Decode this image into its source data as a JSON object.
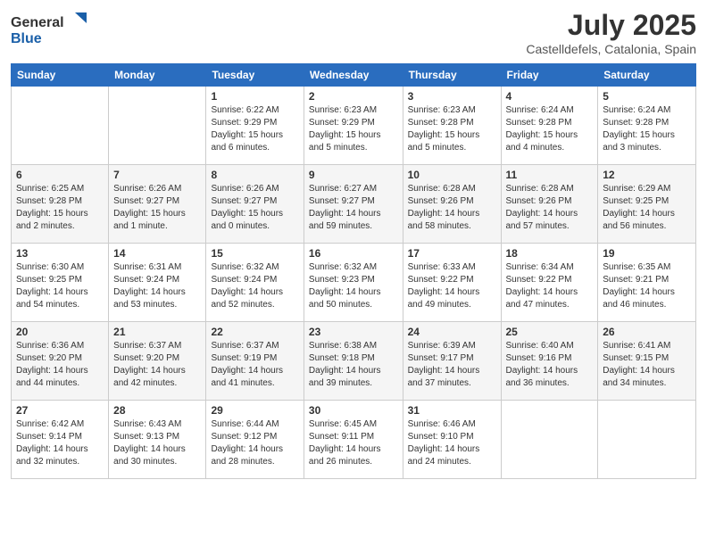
{
  "header": {
    "logo_general": "General",
    "logo_blue": "Blue",
    "month_title": "July 2025",
    "location": "Castelldefels, Catalonia, Spain"
  },
  "weekdays": [
    "Sunday",
    "Monday",
    "Tuesday",
    "Wednesday",
    "Thursday",
    "Friday",
    "Saturday"
  ],
  "weeks": [
    [
      {
        "day": "",
        "info": ""
      },
      {
        "day": "",
        "info": ""
      },
      {
        "day": "1",
        "info": "Sunrise: 6:22 AM\nSunset: 9:29 PM\nDaylight: 15 hours and 6 minutes."
      },
      {
        "day": "2",
        "info": "Sunrise: 6:23 AM\nSunset: 9:29 PM\nDaylight: 15 hours and 5 minutes."
      },
      {
        "day": "3",
        "info": "Sunrise: 6:23 AM\nSunset: 9:28 PM\nDaylight: 15 hours and 5 minutes."
      },
      {
        "day": "4",
        "info": "Sunrise: 6:24 AM\nSunset: 9:28 PM\nDaylight: 15 hours and 4 minutes."
      },
      {
        "day": "5",
        "info": "Sunrise: 6:24 AM\nSunset: 9:28 PM\nDaylight: 15 hours and 3 minutes."
      }
    ],
    [
      {
        "day": "6",
        "info": "Sunrise: 6:25 AM\nSunset: 9:28 PM\nDaylight: 15 hours and 2 minutes."
      },
      {
        "day": "7",
        "info": "Sunrise: 6:26 AM\nSunset: 9:27 PM\nDaylight: 15 hours and 1 minute."
      },
      {
        "day": "8",
        "info": "Sunrise: 6:26 AM\nSunset: 9:27 PM\nDaylight: 15 hours and 0 minutes."
      },
      {
        "day": "9",
        "info": "Sunrise: 6:27 AM\nSunset: 9:27 PM\nDaylight: 14 hours and 59 minutes."
      },
      {
        "day": "10",
        "info": "Sunrise: 6:28 AM\nSunset: 9:26 PM\nDaylight: 14 hours and 58 minutes."
      },
      {
        "day": "11",
        "info": "Sunrise: 6:28 AM\nSunset: 9:26 PM\nDaylight: 14 hours and 57 minutes."
      },
      {
        "day": "12",
        "info": "Sunrise: 6:29 AM\nSunset: 9:25 PM\nDaylight: 14 hours and 56 minutes."
      }
    ],
    [
      {
        "day": "13",
        "info": "Sunrise: 6:30 AM\nSunset: 9:25 PM\nDaylight: 14 hours and 54 minutes."
      },
      {
        "day": "14",
        "info": "Sunrise: 6:31 AM\nSunset: 9:24 PM\nDaylight: 14 hours and 53 minutes."
      },
      {
        "day": "15",
        "info": "Sunrise: 6:32 AM\nSunset: 9:24 PM\nDaylight: 14 hours and 52 minutes."
      },
      {
        "day": "16",
        "info": "Sunrise: 6:32 AM\nSunset: 9:23 PM\nDaylight: 14 hours and 50 minutes."
      },
      {
        "day": "17",
        "info": "Sunrise: 6:33 AM\nSunset: 9:22 PM\nDaylight: 14 hours and 49 minutes."
      },
      {
        "day": "18",
        "info": "Sunrise: 6:34 AM\nSunset: 9:22 PM\nDaylight: 14 hours and 47 minutes."
      },
      {
        "day": "19",
        "info": "Sunrise: 6:35 AM\nSunset: 9:21 PM\nDaylight: 14 hours and 46 minutes."
      }
    ],
    [
      {
        "day": "20",
        "info": "Sunrise: 6:36 AM\nSunset: 9:20 PM\nDaylight: 14 hours and 44 minutes."
      },
      {
        "day": "21",
        "info": "Sunrise: 6:37 AM\nSunset: 9:20 PM\nDaylight: 14 hours and 42 minutes."
      },
      {
        "day": "22",
        "info": "Sunrise: 6:37 AM\nSunset: 9:19 PM\nDaylight: 14 hours and 41 minutes."
      },
      {
        "day": "23",
        "info": "Sunrise: 6:38 AM\nSunset: 9:18 PM\nDaylight: 14 hours and 39 minutes."
      },
      {
        "day": "24",
        "info": "Sunrise: 6:39 AM\nSunset: 9:17 PM\nDaylight: 14 hours and 37 minutes."
      },
      {
        "day": "25",
        "info": "Sunrise: 6:40 AM\nSunset: 9:16 PM\nDaylight: 14 hours and 36 minutes."
      },
      {
        "day": "26",
        "info": "Sunrise: 6:41 AM\nSunset: 9:15 PM\nDaylight: 14 hours and 34 minutes."
      }
    ],
    [
      {
        "day": "27",
        "info": "Sunrise: 6:42 AM\nSunset: 9:14 PM\nDaylight: 14 hours and 32 minutes."
      },
      {
        "day": "28",
        "info": "Sunrise: 6:43 AM\nSunset: 9:13 PM\nDaylight: 14 hours and 30 minutes."
      },
      {
        "day": "29",
        "info": "Sunrise: 6:44 AM\nSunset: 9:12 PM\nDaylight: 14 hours and 28 minutes."
      },
      {
        "day": "30",
        "info": "Sunrise: 6:45 AM\nSunset: 9:11 PM\nDaylight: 14 hours and 26 minutes."
      },
      {
        "day": "31",
        "info": "Sunrise: 6:46 AM\nSunset: 9:10 PM\nDaylight: 14 hours and 24 minutes."
      },
      {
        "day": "",
        "info": ""
      },
      {
        "day": "",
        "info": ""
      }
    ]
  ]
}
